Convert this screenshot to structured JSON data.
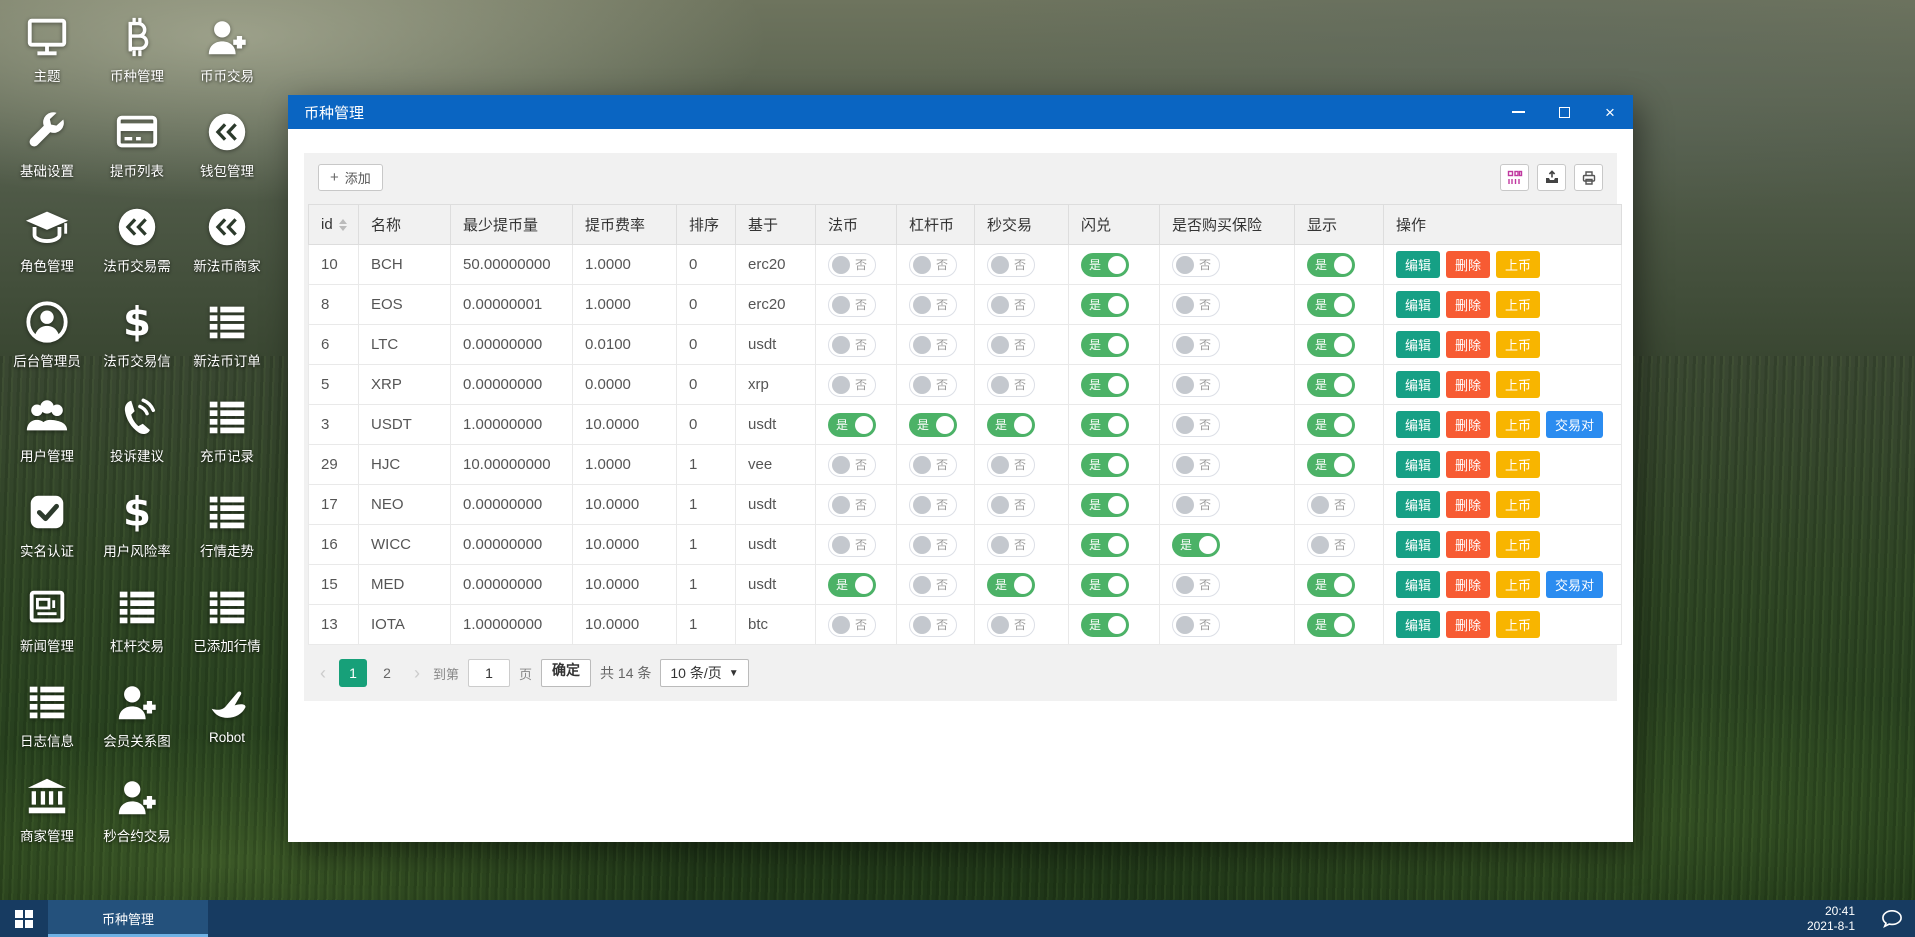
{
  "desktop": {
    "items": [
      {
        "label": "主题",
        "icon": "monitor-icon"
      },
      {
        "label": "基础设置",
        "icon": "wrench-icon"
      },
      {
        "label": "角色管理",
        "icon": "graduation-cap-icon"
      },
      {
        "label": "后台管理员",
        "icon": "admin-user-icon"
      },
      {
        "label": "用户管理",
        "icon": "users-icon"
      },
      {
        "label": "实名认证",
        "icon": "check-square-icon"
      },
      {
        "label": "新闻管理",
        "icon": "newspaper-icon"
      },
      {
        "label": "日志信息",
        "icon": "list-icon"
      },
      {
        "label": "商家管理",
        "icon": "bank-icon"
      },
      {
        "label": "币种管理",
        "icon": "bitcoin-icon"
      },
      {
        "label": "提币列表",
        "icon": "credit-card-icon"
      },
      {
        "label": "法币交易需",
        "icon": "coin-icon"
      },
      {
        "label": "法币交易信",
        "icon": "dollar-icon"
      },
      {
        "label": "投诉建议",
        "icon": "phone-volume-icon"
      },
      {
        "label": "用户风险率",
        "icon": "dollar-icon"
      },
      {
        "label": "杠杆交易",
        "icon": "list-icon"
      },
      {
        "label": "会员关系图",
        "icon": "user-plus-icon"
      },
      {
        "label": "秒合约交易",
        "icon": "user-plus-icon"
      },
      {
        "label": "币币交易",
        "icon": "user-plus-icon"
      },
      {
        "label": "钱包管理",
        "icon": "coin-icon"
      },
      {
        "label": "新法币商家",
        "icon": "coin-icon"
      },
      {
        "label": "新法币订单",
        "icon": "list-icon"
      },
      {
        "label": "充币记录",
        "icon": "list-icon"
      },
      {
        "label": "行情走势",
        "icon": "list-icon"
      },
      {
        "label": "已添加行情",
        "icon": "list-icon"
      },
      {
        "label": "Robot",
        "icon": "hand-icon"
      }
    ]
  },
  "window": {
    "title": "币种管理",
    "toolbar": {
      "add_label": "添加",
      "icons": [
        "columns-icon",
        "export-icon",
        "print-icon"
      ]
    },
    "table": {
      "columns": [
        {
          "key": "id",
          "label": "id",
          "sortable": true
        },
        {
          "key": "name",
          "label": "名称"
        },
        {
          "key": "min_withdraw",
          "label": "最少提币量"
        },
        {
          "key": "fee_rate",
          "label": "提币费率"
        },
        {
          "key": "sort",
          "label": "排序"
        },
        {
          "key": "base",
          "label": "基于"
        },
        {
          "key": "fiat",
          "label": "法币"
        },
        {
          "key": "lever",
          "label": "杠杆币"
        },
        {
          "key": "seconds",
          "label": "秒交易"
        },
        {
          "key": "flash",
          "label": "闪兑"
        },
        {
          "key": "insurance",
          "label": "是否购买保险"
        },
        {
          "key": "show",
          "label": "显示"
        },
        {
          "key": "actions",
          "label": "操作"
        }
      ],
      "rows": [
        {
          "id": "10",
          "name": "BCH",
          "min_withdraw": "50.00000000",
          "fee_rate": "1.0000",
          "sort": "0",
          "base": "erc20",
          "fiat": false,
          "lever": false,
          "seconds": false,
          "flash": true,
          "insurance": false,
          "show": true,
          "has_pair": false
        },
        {
          "id": "8",
          "name": "EOS",
          "min_withdraw": "0.00000001",
          "fee_rate": "1.0000",
          "sort": "0",
          "base": "erc20",
          "fiat": false,
          "lever": false,
          "seconds": false,
          "flash": true,
          "insurance": false,
          "show": true,
          "has_pair": false
        },
        {
          "id": "6",
          "name": "LTC",
          "min_withdraw": "0.00000000",
          "fee_rate": "0.0100",
          "sort": "0",
          "base": "usdt",
          "fiat": false,
          "lever": false,
          "seconds": false,
          "flash": true,
          "insurance": false,
          "show": true,
          "has_pair": false
        },
        {
          "id": "5",
          "name": "XRP",
          "min_withdraw": "0.00000000",
          "fee_rate": "0.0000",
          "sort": "0",
          "base": "xrp",
          "fiat": false,
          "lever": false,
          "seconds": false,
          "flash": true,
          "insurance": false,
          "show": true,
          "has_pair": false
        },
        {
          "id": "3",
          "name": "USDT",
          "min_withdraw": "1.00000000",
          "fee_rate": "10.0000",
          "sort": "0",
          "base": "usdt",
          "fiat": true,
          "lever": true,
          "seconds": true,
          "flash": true,
          "insurance": false,
          "show": true,
          "has_pair": true
        },
        {
          "id": "29",
          "name": "HJC",
          "min_withdraw": "10.00000000",
          "fee_rate": "1.0000",
          "sort": "1",
          "base": "vee",
          "fiat": false,
          "lever": false,
          "seconds": false,
          "flash": true,
          "insurance": false,
          "show": true,
          "has_pair": false
        },
        {
          "id": "17",
          "name": "NEO",
          "min_withdraw": "0.00000000",
          "fee_rate": "10.0000",
          "sort": "1",
          "base": "usdt",
          "fiat": false,
          "lever": false,
          "seconds": false,
          "flash": true,
          "insurance": false,
          "show": false,
          "has_pair": false
        },
        {
          "id": "16",
          "name": "WICC",
          "min_withdraw": "0.00000000",
          "fee_rate": "10.0000",
          "sort": "1",
          "base": "usdt",
          "fiat": false,
          "lever": false,
          "seconds": false,
          "flash": true,
          "insurance": true,
          "show": false,
          "has_pair": false
        },
        {
          "id": "15",
          "name": "MED",
          "min_withdraw": "0.00000000",
          "fee_rate": "10.0000",
          "sort": "1",
          "base": "usdt",
          "fiat": true,
          "lever": false,
          "seconds": true,
          "flash": true,
          "insurance": false,
          "show": true,
          "has_pair": true
        },
        {
          "id": "13",
          "name": "IOTA",
          "min_withdraw": "1.00000000",
          "fee_rate": "10.0000",
          "sort": "1",
          "base": "btc",
          "fiat": false,
          "lever": false,
          "seconds": false,
          "flash": true,
          "insurance": false,
          "show": true,
          "has_pair": false
        }
      ]
    },
    "toggle": {
      "on": "是",
      "off": "否"
    },
    "actions": {
      "edit": "编辑",
      "delete": "删除",
      "listing": "上币",
      "pair": "交易对"
    },
    "pagination": {
      "prev": "‹",
      "next": "›",
      "pages": [
        "1",
        "2"
      ],
      "active_page": "1",
      "goto_label": "到第",
      "page_value": "1",
      "page_suffix": "页",
      "confirm": "确定",
      "total": "共 14 条",
      "per_page": "10 条/页"
    }
  },
  "taskbar": {
    "task": "币种管理",
    "time": "20:41",
    "date": "2021-8-1"
  },
  "colors": {
    "titlebar": "#0a65c2",
    "toggle_on": "#4cb267",
    "edit": "#16a085",
    "delete": "#f75b33",
    "listing": "#f8b500",
    "pair": "#2b8cf0",
    "page_active": "#17a079",
    "taskbar": "#173b61"
  }
}
